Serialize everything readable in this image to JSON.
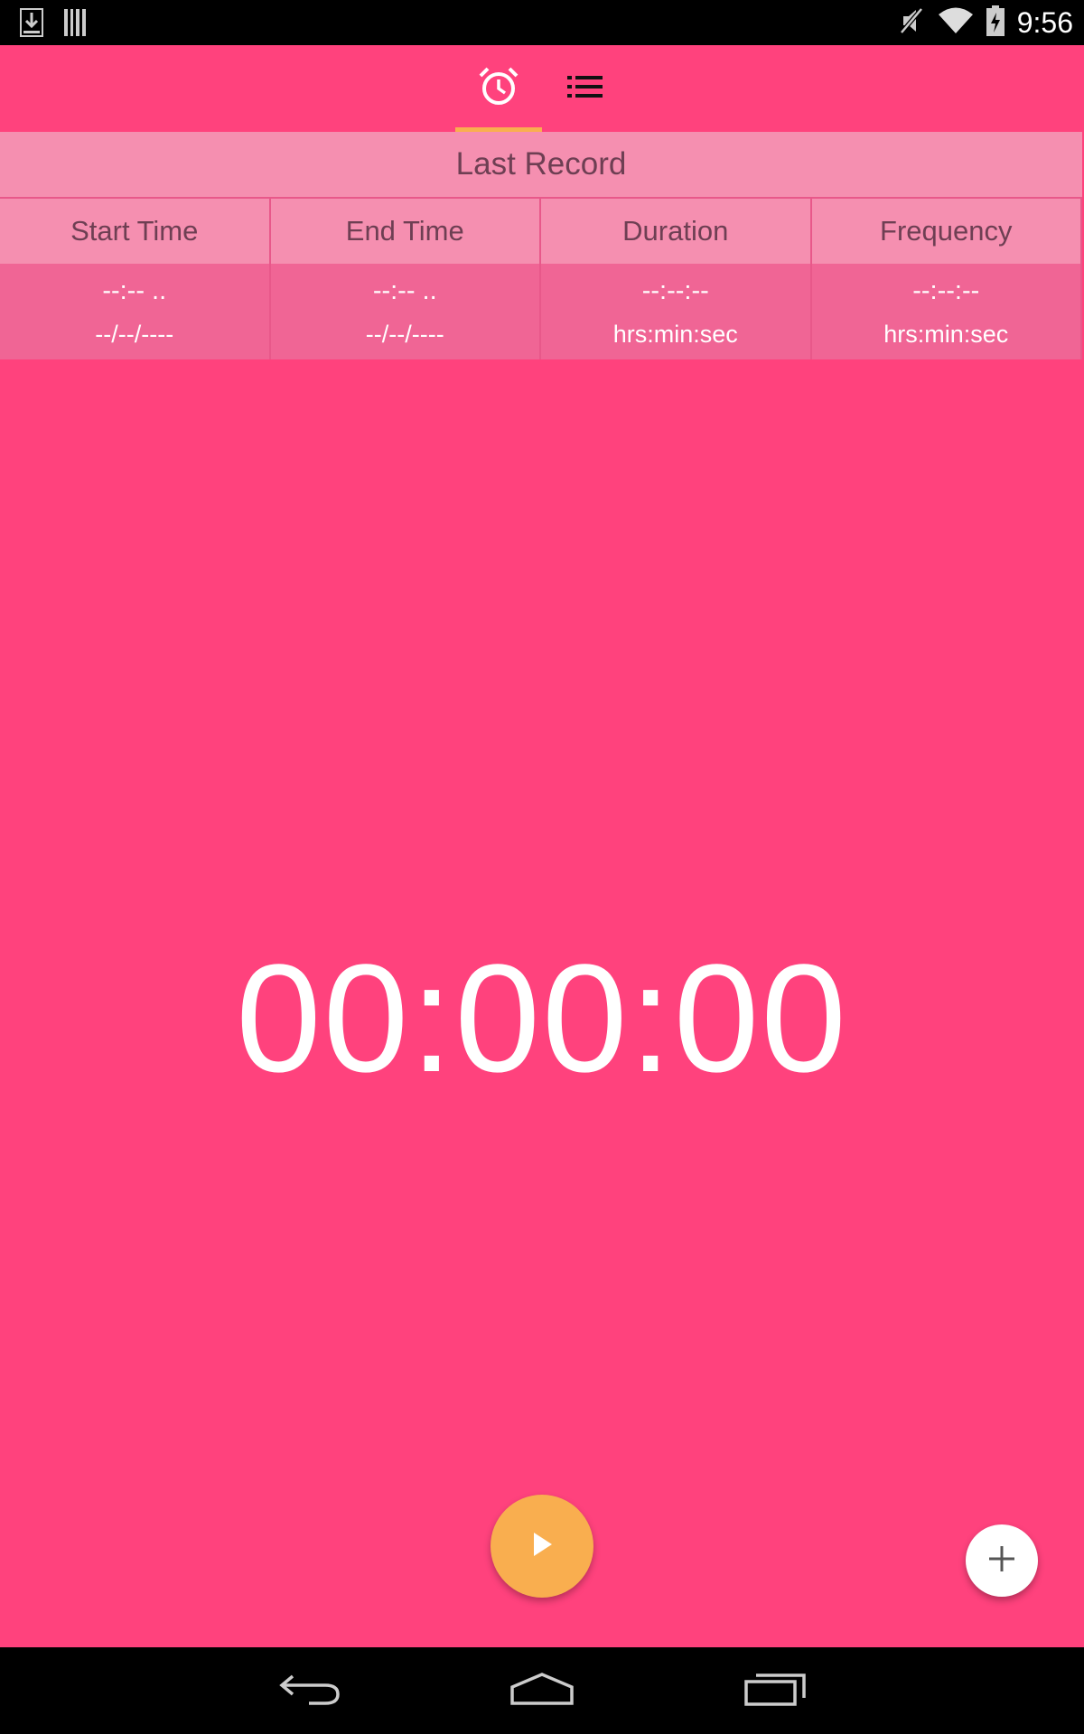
{
  "status_bar": {
    "time": "9:56",
    "left_icons": [
      "download-icon",
      "barcode-icon"
    ],
    "right_icons": [
      "mute-icon",
      "wifi-icon",
      "battery-charging-icon"
    ]
  },
  "tabs": [
    {
      "icon": "alarm-clock-icon",
      "selected": true
    },
    {
      "icon": "list-icon",
      "selected": false
    }
  ],
  "last_record": {
    "title": "Last Record",
    "columns": [
      "Start Time",
      "End Time",
      "Duration",
      "Frequency"
    ],
    "values": [
      {
        "main": "--:-- ..",
        "sub": "--/--/----"
      },
      {
        "main": "--:-- ..",
        "sub": "--/--/----"
      },
      {
        "main": "--:--:--",
        "sub": "hrs:min:sec"
      },
      {
        "main": "--:--:--",
        "sub": "hrs:min:sec"
      }
    ]
  },
  "timer": {
    "display": "00:00:00"
  },
  "buttons": {
    "play": "play-icon",
    "add": "plus-icon"
  },
  "nav_bar": [
    "back-icon",
    "home-icon",
    "recents-icon"
  ],
  "colors": {
    "background": "#FF427D",
    "accent": "#F9AE4F",
    "header_cell": "#F58FB0",
    "value_cell": "#F06595"
  }
}
